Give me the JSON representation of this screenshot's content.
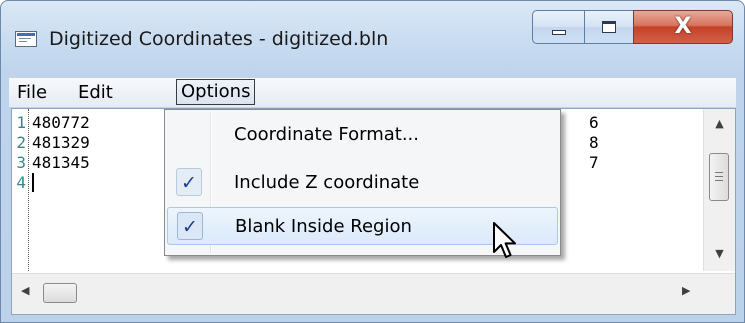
{
  "window": {
    "title": "Digitized Coordinates - digitized.bln",
    "close_label": "X"
  },
  "menubar": {
    "items": [
      {
        "label": "File"
      },
      {
        "label": "Edit"
      },
      {
        "label": "Options"
      }
    ]
  },
  "editor": {
    "lines": [
      {
        "number": "1",
        "text": "480772",
        "tail": "6"
      },
      {
        "number": "2",
        "text": "481329",
        "tail": "8"
      },
      {
        "number": "3",
        "text": "481345",
        "tail": "7"
      },
      {
        "number": "4",
        "text": "",
        "tail": ""
      }
    ]
  },
  "options_menu": {
    "items": [
      {
        "label": "Coordinate Format...",
        "checked": false
      },
      {
        "label": "Include Z coordinate",
        "checked": true
      },
      {
        "label": "Blank Inside Region",
        "checked": true
      }
    ],
    "check_glyph": "✓"
  },
  "colors": {
    "line_number": "#2e8a8a",
    "close_button": "#c4422a",
    "check_mark": "#1a3f8f"
  }
}
